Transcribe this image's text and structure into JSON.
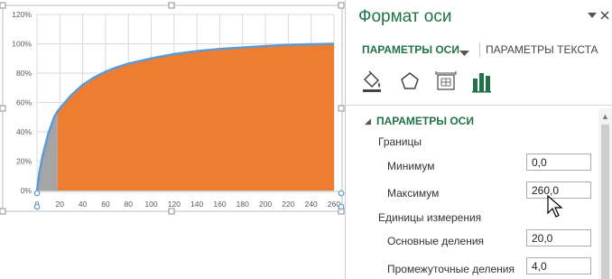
{
  "chart": {
    "y_ticks": [
      "0%",
      "20%",
      "40%",
      "60%",
      "80%",
      "100%",
      "120%"
    ],
    "x_ticks": [
      "0",
      "20",
      "40",
      "60",
      "80",
      "100",
      "120",
      "140",
      "160",
      "180",
      "200",
      "220",
      "240",
      "260"
    ],
    "colors": {
      "main_fill": "#ED7D31",
      "gray_fill": "#A5A5A5",
      "line": "#5B9BD5",
      "grid": "#D9D9D9"
    }
  },
  "chart_data": {
    "type": "area",
    "xlim": [
      0,
      260
    ],
    "ylim": [
      0,
      1.2
    ],
    "x": [
      0,
      2,
      5,
      10,
      15,
      18,
      20,
      30,
      40,
      50,
      60,
      70,
      80,
      100,
      120,
      140,
      160,
      180,
      200,
      220,
      240,
      260
    ],
    "y": [
      0,
      0.12,
      0.24,
      0.39,
      0.5,
      0.54,
      0.56,
      0.65,
      0.72,
      0.77,
      0.81,
      0.84,
      0.865,
      0.9,
      0.93,
      0.95,
      0.965,
      0.975,
      0.985,
      0.992,
      0.997,
      1.0
    ],
    "gray_region_x": [
      0,
      18
    ]
  },
  "pane": {
    "title": "Формат оси",
    "dropdown_icon": "caret-down-icon",
    "close_icon": "close-icon",
    "tab_axis": "ПАРАМЕТРЫ ОСИ",
    "tab_text": "ПАРАМЕТРЫ ТЕКСТА",
    "section_title": "ПАРАМЕТРЫ ОСИ",
    "bounds_label": "Границы",
    "min_label": "Минимум",
    "min_value": "0,0",
    "max_label": "Максимум",
    "max_value": "260,0",
    "units_label": "Единицы измерения",
    "major_label": "Основные деления",
    "major_value": "20,0",
    "minor_label": "Промежуточные деления",
    "minor_value": "4,0"
  }
}
